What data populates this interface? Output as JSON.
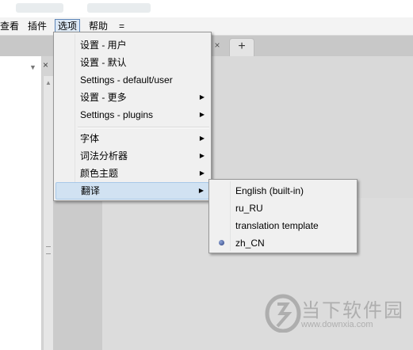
{
  "menubar": {
    "items": [
      "查看",
      "插件",
      "选项",
      "帮助",
      "="
    ],
    "active_index": 2
  },
  "tabs": {
    "close_glyph": "×",
    "new_tab_glyph": "+"
  },
  "sidebar": {
    "dropdown_glyph": "▼",
    "close_glyph": "×"
  },
  "options_menu": {
    "items": [
      {
        "label": "设置 - 用户",
        "submenu": false
      },
      {
        "label": "设置 - 默认",
        "submenu": false
      },
      {
        "label": "Settings - default/user",
        "submenu": false
      },
      {
        "label": "设置 - 更多",
        "submenu": true
      },
      {
        "label": "Settings - plugins",
        "submenu": true
      },
      {
        "label": "字体",
        "submenu": true
      },
      {
        "label": "词法分析器",
        "submenu": true
      },
      {
        "label": "颜色主题",
        "submenu": true
      },
      {
        "label": "翻译",
        "submenu": true,
        "highlighted": true
      }
    ],
    "arrow_glyph": "▶"
  },
  "translation_submenu": {
    "items": [
      {
        "label": "English (built-in)",
        "selected": false
      },
      {
        "label": "ru_RU",
        "selected": false
      },
      {
        "label": "translation template",
        "selected": false
      },
      {
        "label": "zh_CN",
        "selected": true
      }
    ]
  },
  "watermark": {
    "title": "当下软件园",
    "url": "www.downxia.com"
  },
  "colors": {
    "menu_bg": "#f0f0f0",
    "highlight": "#d1e2f2",
    "watermark": "#8a8a8a"
  }
}
